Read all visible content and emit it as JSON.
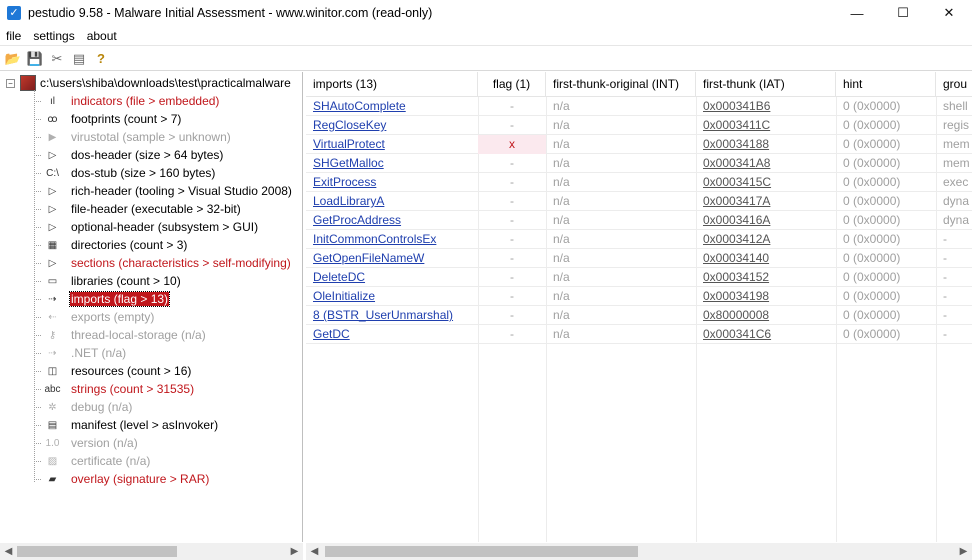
{
  "window": {
    "title": "pestudio 9.58 - Malware Initial Assessment - www.winitor.com (read-only)",
    "minimize": "—",
    "maximize": "☐",
    "close": "✕"
  },
  "menu": [
    "file",
    "settings",
    "about"
  ],
  "toolbar": {
    "icons": [
      "open-folder-icon",
      "save-icon",
      "tools-icon",
      "document-icon",
      "help-icon"
    ],
    "glyphs": [
      "📂",
      "💾",
      "✂",
      "▤",
      "?"
    ]
  },
  "tree": {
    "root": "c:\\users\\shiba\\downloads\\test\\practicalmalware",
    "items": [
      {
        "label": "indicators (file > embedded)",
        "style": "red",
        "icon": "bar-chart-icon",
        "glyph": "ıl"
      },
      {
        "label": "footprints (count > 7)",
        "style": "normal",
        "icon": "fingerprint-icon",
        "glyph": "ꝏ"
      },
      {
        "label": "virustotal (sample > unknown)",
        "style": "grey",
        "icon": "virustotal-icon",
        "glyph": "▶"
      },
      {
        "label": "dos-header (size > 64 bytes)",
        "style": "normal",
        "icon": "chevron-right-icon",
        "glyph": "▷"
      },
      {
        "label": "dos-stub (size > 160 bytes)",
        "style": "normal",
        "icon": "console-icon",
        "glyph": "C:\\"
      },
      {
        "label": "rich-header (tooling > Visual Studio 2008)",
        "style": "normal",
        "icon": "chevron-right-icon",
        "glyph": "▷"
      },
      {
        "label": "file-header (executable > 32-bit)",
        "style": "normal",
        "icon": "chevron-right-icon",
        "glyph": "▷"
      },
      {
        "label": "optional-header (subsystem > GUI)",
        "style": "normal",
        "icon": "chevron-right-icon",
        "glyph": "▷"
      },
      {
        "label": "directories (count > 3)",
        "style": "normal",
        "icon": "grid-icon",
        "glyph": "▦"
      },
      {
        "label": "sections (characteristics > self-modifying)",
        "style": "red",
        "icon": "chevron-right-icon",
        "glyph": "▷"
      },
      {
        "label": "libraries (count > 10)",
        "style": "normal",
        "icon": "library-icon",
        "glyph": "▭"
      },
      {
        "label": "imports (flag > 13)",
        "style": "selected",
        "icon": "imports-icon",
        "glyph": "⇢"
      },
      {
        "label": "exports (empty)",
        "style": "grey",
        "icon": "exports-icon",
        "glyph": "⇠"
      },
      {
        "label": "thread-local-storage (n/a)",
        "style": "grey",
        "icon": "key-icon",
        "glyph": "⚷"
      },
      {
        "label": ".NET (n/a)",
        "style": "grey",
        "icon": "dotnet-icon",
        "glyph": "⇢"
      },
      {
        "label": "resources (count > 16)",
        "style": "normal",
        "icon": "resources-icon",
        "glyph": "◫"
      },
      {
        "label": "strings (count > 31535)",
        "style": "red",
        "icon": "abc-icon",
        "glyph": "abc"
      },
      {
        "label": "debug (n/a)",
        "style": "grey",
        "icon": "bug-icon",
        "glyph": "✲"
      },
      {
        "label": "manifest (level > asInvoker)",
        "style": "normal",
        "icon": "manifest-icon",
        "glyph": "▤"
      },
      {
        "label": "version (n/a)",
        "style": "grey",
        "icon": "version-icon",
        "glyph": "1.0"
      },
      {
        "label": "certificate (n/a)",
        "style": "grey",
        "icon": "certificate-icon",
        "glyph": "▨"
      },
      {
        "label": "overlay (signature > RAR)",
        "style": "red",
        "icon": "archive-icon",
        "glyph": "▰"
      }
    ]
  },
  "table": {
    "columns": [
      "imports (13)",
      "flag (1)",
      "first-thunk-original (INT)",
      "first-thunk (IAT)",
      "hint",
      "grou"
    ],
    "rows": [
      {
        "name": "SHAutoComplete",
        "flag": "-",
        "int": "n/a",
        "iat": "0x000341B6",
        "hint": "0 (0x0000)",
        "group": "shell"
      },
      {
        "name": "RegCloseKey",
        "flag": "-",
        "int": "n/a",
        "iat": "0x0003411C",
        "hint": "0 (0x0000)",
        "group": "regis"
      },
      {
        "name": "VirtualProtect",
        "flag": "x",
        "int": "n/a",
        "iat": "0x00034188",
        "hint": "0 (0x0000)",
        "group": "mem"
      },
      {
        "name": "SHGetMalloc",
        "flag": "-",
        "int": "n/a",
        "iat": "0x000341A8",
        "hint": "0 (0x0000)",
        "group": "mem"
      },
      {
        "name": "ExitProcess",
        "flag": "-",
        "int": "n/a",
        "iat": "0x0003415C",
        "hint": "0 (0x0000)",
        "group": "exec"
      },
      {
        "name": "LoadLibraryA",
        "flag": "-",
        "int": "n/a",
        "iat": "0x0003417A",
        "hint": "0 (0x0000)",
        "group": "dyna"
      },
      {
        "name": "GetProcAddress",
        "flag": "-",
        "int": "n/a",
        "iat": "0x0003416A",
        "hint": "0 (0x0000)",
        "group": "dyna"
      },
      {
        "name": "InitCommonControlsEx",
        "flag": "-",
        "int": "n/a",
        "iat": "0x0003412A",
        "hint": "0 (0x0000)",
        "group": "-"
      },
      {
        "name": "GetOpenFileNameW",
        "flag": "-",
        "int": "n/a",
        "iat": "0x00034140",
        "hint": "0 (0x0000)",
        "group": "-"
      },
      {
        "name": "DeleteDC",
        "flag": "-",
        "int": "n/a",
        "iat": "0x00034152",
        "hint": "0 (0x0000)",
        "group": "-"
      },
      {
        "name": "OleInitialize",
        "flag": "-",
        "int": "n/a",
        "iat": "0x00034198",
        "hint": "0 (0x0000)",
        "group": "-"
      },
      {
        "name": "8 (BSTR_UserUnmarshal)",
        "flag": "-",
        "int": "n/a",
        "iat": "0x80000008",
        "hint": "0 (0x0000)",
        "group": "-"
      },
      {
        "name": "GetDC",
        "flag": "-",
        "int": "n/a",
        "iat": "0x000341C6",
        "hint": "0 (0x0000)",
        "group": "-"
      }
    ]
  },
  "scroll": {
    "left_arrow": "◀",
    "right_arrow": "▶"
  }
}
